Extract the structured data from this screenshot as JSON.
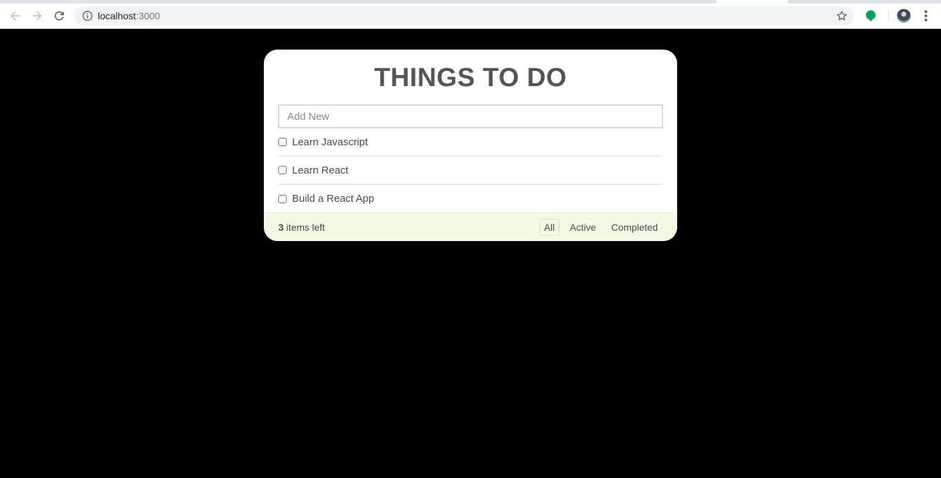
{
  "browser": {
    "url_host": "localhost",
    "url_port": ":3000",
    "icons": [
      "back-arrow-icon",
      "forward-arrow-icon",
      "reload-icon",
      "info-icon",
      "bookmark-star-icon",
      "extension-icon",
      "profile-avatar",
      "menu-dots-icon"
    ]
  },
  "app": {
    "title": "THINGS TO DO",
    "input_placeholder": "Add New",
    "items": [
      {
        "label": "Learn Javascript",
        "checked": false
      },
      {
        "label": "Learn React",
        "checked": false
      },
      {
        "label": "Build a React App",
        "checked": false
      }
    ],
    "footer": {
      "count": "3",
      "count_suffix": " items left",
      "filters": [
        "All",
        "Active",
        "Completed"
      ],
      "selected_filter": "All"
    }
  },
  "colors": {
    "page_background": "#000000",
    "card_background": "#ffffff",
    "footer_background": "#f2f9e5",
    "title_color": "#555555",
    "extension_green": "#0f9d58"
  }
}
